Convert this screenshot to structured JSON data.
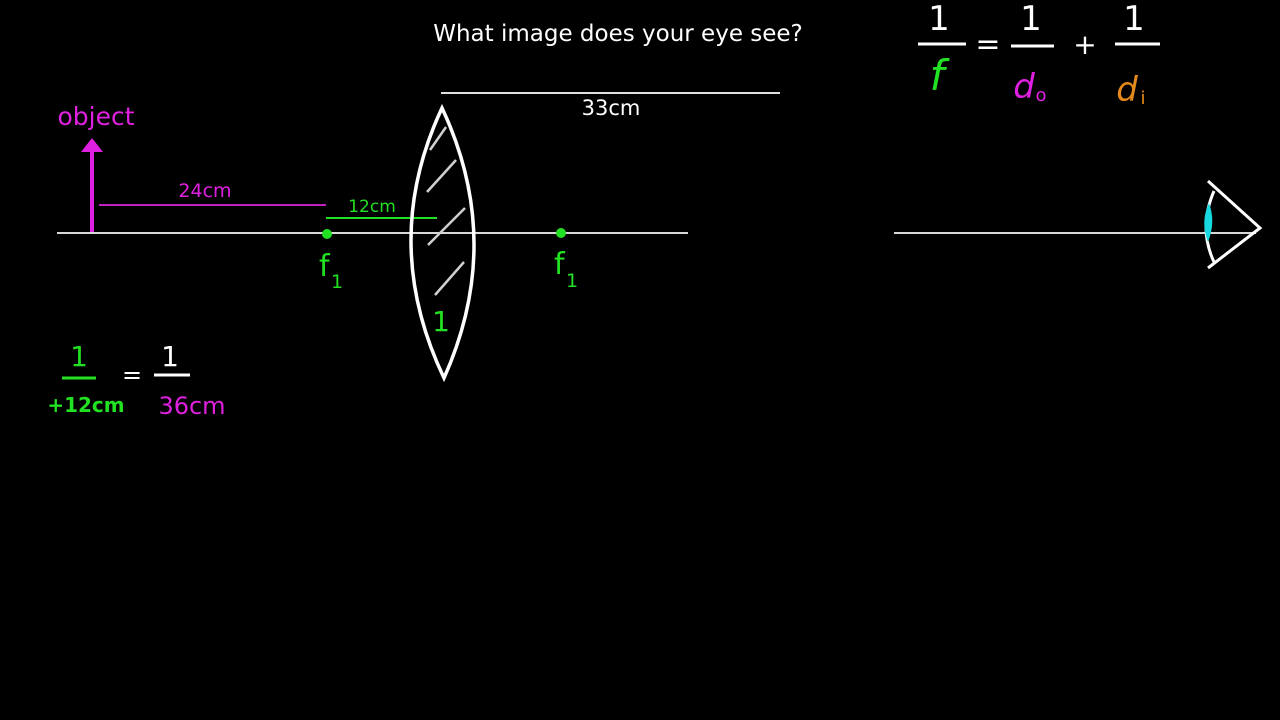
{
  "title": "What image does your eye see?",
  "labels": {
    "object": "object",
    "dist_object_focal": "24cm",
    "dist_focal_lens": "12cm",
    "dist_lens_eye": "33cm",
    "focal_left": "f",
    "focal_left_sub": "1",
    "focal_right": "f",
    "focal_right_sub": "1",
    "lens_number": "1"
  },
  "lens_equation": {
    "numerator_f": "1",
    "denominator_f": "f",
    "equals": "=",
    "numerator_do": "1",
    "denominator_do": "d",
    "denominator_do_sub": "o",
    "plus": "+",
    "numerator_di": "1",
    "denominator_di": "d",
    "denominator_di_sub": "i"
  },
  "worked_equation": {
    "left_numerator": "1",
    "left_denominator": "+12cm",
    "equals": "=",
    "right_numerator": "1",
    "right_denominator": "36cm"
  },
  "colors": {
    "background": "#000000",
    "white": "#ffffff",
    "magenta": "#e020e0",
    "green": "#22e022",
    "orange": "#e58a1a",
    "cyan": "#18d8e0"
  }
}
